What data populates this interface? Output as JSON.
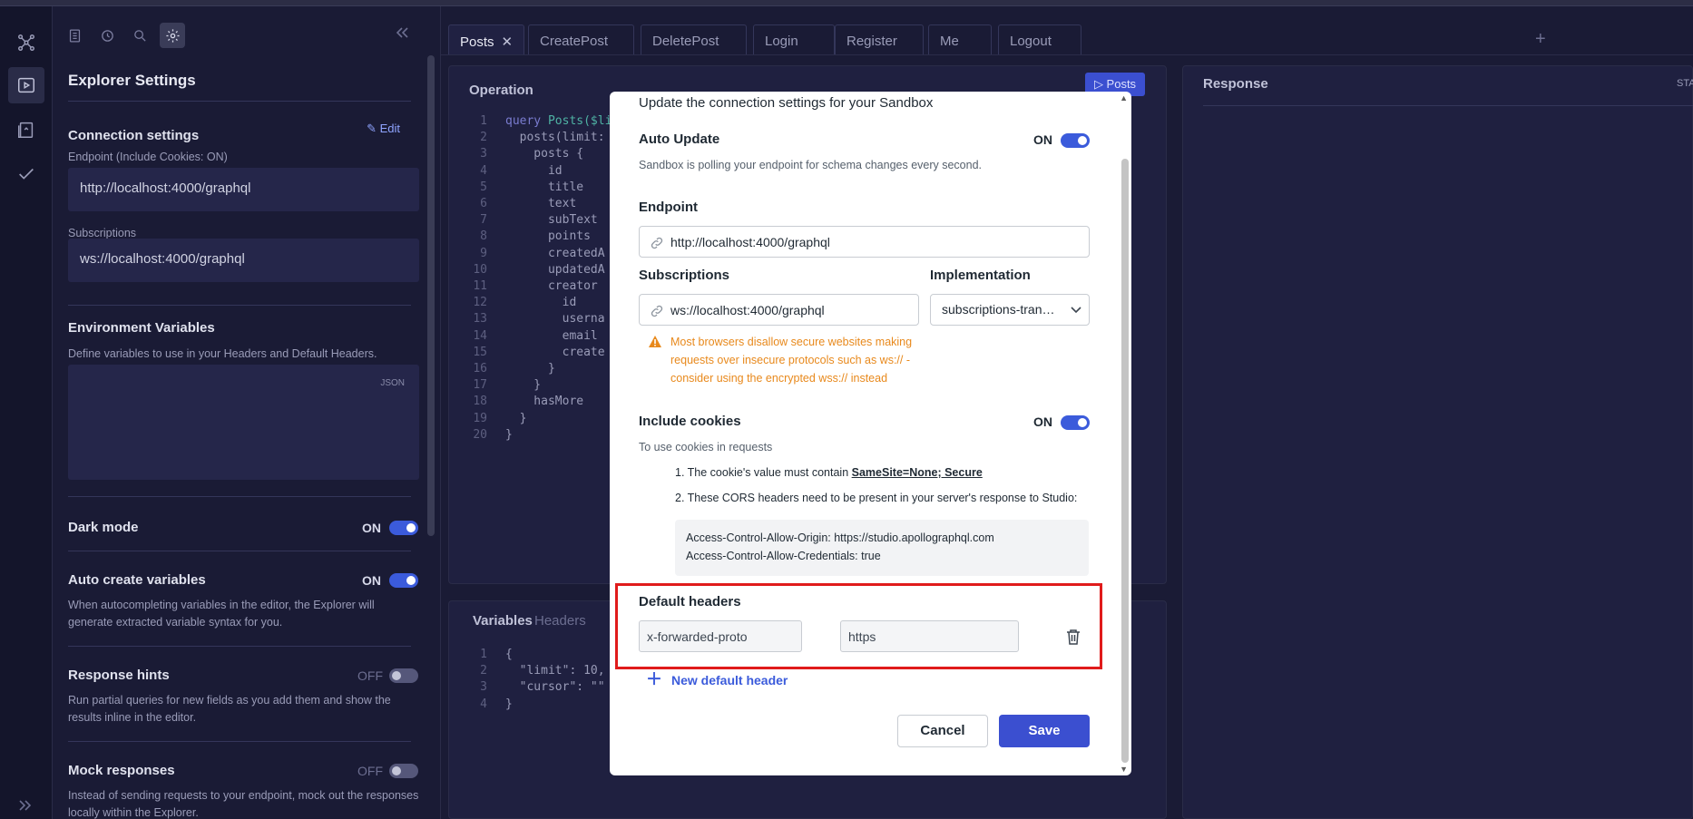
{
  "settings": {
    "title": "Explorer Settings",
    "connection": {
      "heading": "Connection settings",
      "edit_label": "Edit",
      "endpoint_label": "Endpoint (Include Cookies: ON)",
      "endpoint_value": "http://localhost:4000/graphql",
      "subscriptions_label": "Subscriptions",
      "subscriptions_value": "ws://localhost:4000/graphql"
    },
    "env": {
      "heading": "Environment Variables",
      "desc": "Define variables to use in your Headers and Default Headers.",
      "json_tag": "JSON"
    },
    "dark_mode": {
      "label": "Dark mode",
      "state": "ON"
    },
    "auto_create": {
      "label": "Auto create variables",
      "state": "ON",
      "desc": "When autocompleting variables in the editor, the Explorer will generate extracted variable syntax for you."
    },
    "response_hints": {
      "label": "Response hints",
      "state": "OFF",
      "desc": "Run partial queries for new fields as you add them and show the results inline in the editor."
    },
    "mock": {
      "label": "Mock responses",
      "state": "OFF",
      "desc": "Instead of sending requests to your endpoint, mock out the responses locally within the Explorer."
    }
  },
  "tabs": [
    "Posts",
    "CreatePost",
    "DeletePost",
    "Login",
    "Register",
    "Me",
    "Logout"
  ],
  "operation": {
    "title": "Operation",
    "run_label": "▷ Posts",
    "lines": [
      {
        "n": "1",
        "a": "query ",
        "b": "Posts($li",
        "c": ""
      },
      {
        "n": "2",
        "a": "",
        "b": "",
        "c": "  posts(limit:"
      },
      {
        "n": "3",
        "a": "",
        "b": "",
        "c": "    posts {"
      },
      {
        "n": "4",
        "a": "",
        "b": "",
        "c": "      id"
      },
      {
        "n": "5",
        "a": "",
        "b": "",
        "c": "      title"
      },
      {
        "n": "6",
        "a": "",
        "b": "",
        "c": "      text"
      },
      {
        "n": "7",
        "a": "",
        "b": "",
        "c": "      subText"
      },
      {
        "n": "8",
        "a": "",
        "b": "",
        "c": "      points"
      },
      {
        "n": "9",
        "a": "",
        "b": "",
        "c": "      createdA"
      },
      {
        "n": "10",
        "a": "",
        "b": "",
        "c": "      updatedA"
      },
      {
        "n": "11",
        "a": "",
        "b": "",
        "c": "      creator"
      },
      {
        "n": "12",
        "a": "",
        "b": "",
        "c": "        id"
      },
      {
        "n": "13",
        "a": "",
        "b": "",
        "c": "        userna"
      },
      {
        "n": "14",
        "a": "",
        "b": "",
        "c": "        email"
      },
      {
        "n": "15",
        "a": "",
        "b": "",
        "c": "        create"
      },
      {
        "n": "16",
        "a": "",
        "b": "",
        "c": "      }"
      },
      {
        "n": "17",
        "a": "",
        "b": "",
        "c": "    }"
      },
      {
        "n": "18",
        "a": "",
        "b": "",
        "c": "    hasMore"
      },
      {
        "n": "19",
        "a": "",
        "b": "",
        "c": "  }"
      },
      {
        "n": "20",
        "a": "",
        "b": "",
        "c": "}"
      }
    ]
  },
  "variables": {
    "tab_variables": "Variables",
    "tab_headers": "Headers",
    "lines": [
      {
        "n": "1",
        "t": "{"
      },
      {
        "n": "2",
        "t": "  \"limit\": 10,"
      },
      {
        "n": "3",
        "t": "  \"cursor\": \"\""
      },
      {
        "n": "4",
        "t": "}"
      }
    ]
  },
  "response": {
    "title": "Response",
    "status": "STA"
  },
  "modal": {
    "intro": "Update the connection settings for your Sandbox",
    "auto_update": {
      "label": "Auto Update",
      "state": "ON",
      "desc": "Sandbox is polling your endpoint for schema changes every second."
    },
    "endpoint": {
      "label": "Endpoint",
      "value": "http://localhost:4000/graphql"
    },
    "subscriptions": {
      "label": "Subscriptions",
      "value": "ws://localhost:4000/graphql"
    },
    "implementation": {
      "label": "Implementation",
      "value": "subscriptions-tran…"
    },
    "warning": "Most browsers disallow secure websites making requests over insecure protocols such as ws:// - consider using the encrypted wss:// instead",
    "cookies": {
      "label": "Include cookies",
      "state": "ON",
      "desc": "To use cookies in requests",
      "item1_prefix": "1. The cookie's value must contain ",
      "item1_link": "SameSite=None; Secure",
      "item2": "2. These CORS headers need to be present in your server's response to Studio:",
      "header1": "Access-Control-Allow-Origin: https://studio.apollographql.com",
      "header2": "Access-Control-Allow-Credentials: true"
    },
    "default_headers": {
      "label": "Default headers",
      "key": "x-forwarded-proto",
      "value": "https",
      "new_label": "New default header"
    },
    "cancel_label": "Cancel",
    "save_label": "Save"
  },
  "colors": {
    "accent": "#3b4fd0",
    "warning": "#e8891c",
    "highlight": "#e01b1b"
  }
}
